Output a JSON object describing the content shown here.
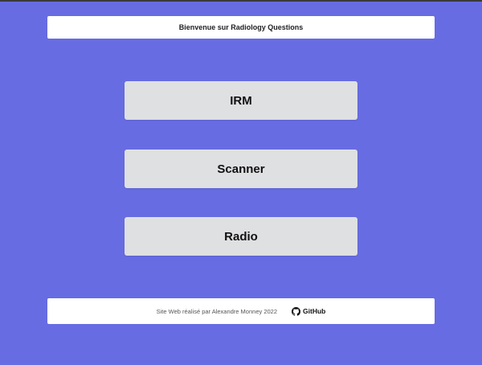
{
  "header": {
    "title": "Bienvenue sur Radiology Questions"
  },
  "menu": {
    "items": [
      {
        "label": "IRM"
      },
      {
        "label": "Scanner"
      },
      {
        "label": "Radio"
      }
    ]
  },
  "footer": {
    "credit": "Site Web réalisé par Alexandre Monney 2022",
    "github_label": "GitHub",
    "github_icon": "github-icon"
  },
  "colors": {
    "background": "#676ce2",
    "card": "#ffffff",
    "button": "#dfe0e2"
  }
}
